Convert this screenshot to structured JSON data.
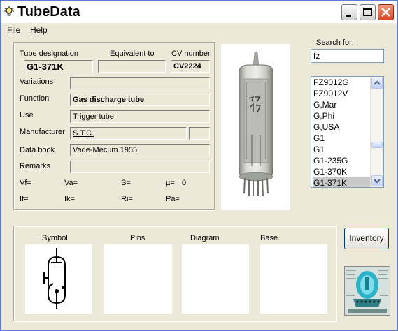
{
  "window": {
    "title": "TubeData"
  },
  "menu": {
    "file": "File",
    "help": "Help"
  },
  "labels": {
    "tube_designation": "Tube designation",
    "equivalent_to": "Equivalent to",
    "cv_number": "CV number",
    "variations": "Variations",
    "function": "Function",
    "use": "Use",
    "manufacturer": "Manufacturer",
    "data_book": "Data book",
    "remarks": "Remarks"
  },
  "fields": {
    "tube_designation": "G1-371K",
    "equivalent_to": "",
    "cv_number": "CV2224",
    "variations": "",
    "function": "Gas discharge tube",
    "use": "Trigger tube",
    "manufacturer": "S.T.C.",
    "manufacturer_extra": "",
    "data_book": "Vade-Mecum 1955",
    "remarks": ""
  },
  "params": {
    "vf": "Vf=",
    "va": "Va=",
    "s": "S=",
    "mu": "µ=",
    "mu_value": "0",
    "if": "If=",
    "ik": "Ik=",
    "ri": "Ri=",
    "pa": "Pa="
  },
  "search": {
    "label": "Search for:",
    "value": "fz"
  },
  "results": {
    "items": [
      "FZ9012G",
      "FZ9012V",
      "G,Mar",
      "G,Phi",
      "G,USA",
      "G1",
      "G1",
      "G1-235G",
      "G1-370K",
      "G1-371K"
    ],
    "selected": "G1-371K"
  },
  "photo": {
    "marking": "338 JZ"
  },
  "panels": {
    "symbol": "Symbol",
    "pins": "Pins",
    "diagram": "Diagram",
    "base": "Base"
  },
  "inventory_button": "Inventory",
  "colors": {
    "close_button": "#d8482a",
    "selection": "#c8c8c8",
    "face": "#ece9d8"
  }
}
